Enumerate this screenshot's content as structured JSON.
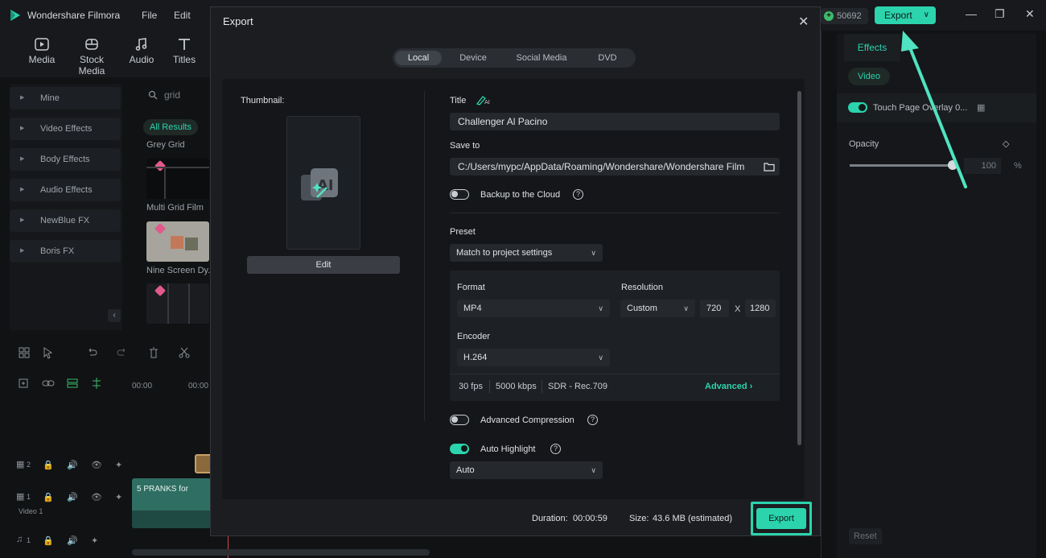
{
  "app": {
    "name": "Wondershare Filmora",
    "menu": [
      "File",
      "Edit"
    ],
    "credits": "50692",
    "export_label": "Export"
  },
  "media_tabs": [
    "Media",
    "Stock Media",
    "Audio",
    "Titles"
  ],
  "sidebar": {
    "items": [
      {
        "label": "Mine"
      },
      {
        "label": "Video Effects"
      },
      {
        "label": "Body Effects"
      },
      {
        "label": "Audio Effects"
      },
      {
        "label": "NewBlue FX"
      },
      {
        "label": "Boris FX"
      }
    ]
  },
  "library": {
    "search_value": "grid",
    "all_results": "All Results",
    "items": [
      "Grey Grid",
      "Multi Grid Film",
      "Nine Screen Dy..."
    ]
  },
  "timeline": {
    "ruler": [
      "00:00",
      "00:00"
    ],
    "tracks": [
      {
        "num": "2",
        "label": ""
      },
      {
        "num": "1",
        "label": "Video 1"
      },
      {
        "num": "1",
        "label": ""
      }
    ],
    "clip_title": "5 PRANKS for"
  },
  "right_panel": {
    "tab": "Effects",
    "video_pill": "Video",
    "effect_name": "Touch Page Overlay 0...",
    "opacity_label": "Opacity",
    "opacity_value": "100",
    "opacity_unit": "%",
    "opacity_level": 1.0,
    "reset": "Reset"
  },
  "export_dialog": {
    "title": "Export",
    "tabs": [
      "Local",
      "Device",
      "Social Media",
      "DVD"
    ],
    "active_tab": "Local",
    "thumbnail_label": "Thumbnail:",
    "edit_label": "Edit",
    "title_label": "Title",
    "title_value": "Challenger Al Pacino",
    "save_to_label": "Save to",
    "save_to_value": "C:/Users/mypc/AppData/Roaming/Wondershare/Wondershare Film",
    "backup_label": "Backup to the Cloud",
    "backup_on": false,
    "preset_label": "Preset",
    "preset_value": "Match to project settings",
    "format_label": "Format",
    "format_value": "MP4",
    "resolution_label": "Resolution",
    "resolution_value": "Custom",
    "res_width": "720",
    "res_x": "X",
    "res_height": "1280",
    "encoder_label": "Encoder",
    "encoder_value": "H.264",
    "fps": "30 fps",
    "bitrate": "5000 kbps",
    "color": "SDR - Rec.709",
    "advanced_label": "Advanced",
    "adv_compression_label": "Advanced Compression",
    "adv_compression_on": false,
    "auto_highlight_label": "Auto Highlight",
    "auto_highlight_on": true,
    "auto_value": "Auto",
    "duration_label": "Duration:",
    "duration_value": "00:00:59",
    "size_label": "Size:",
    "size_value": "43.6 MB (estimated)",
    "export_label": "Export"
  },
  "colors": {
    "accent": "#2bd4ad",
    "bg": "#101214",
    "dialog": "#1b1d21"
  }
}
